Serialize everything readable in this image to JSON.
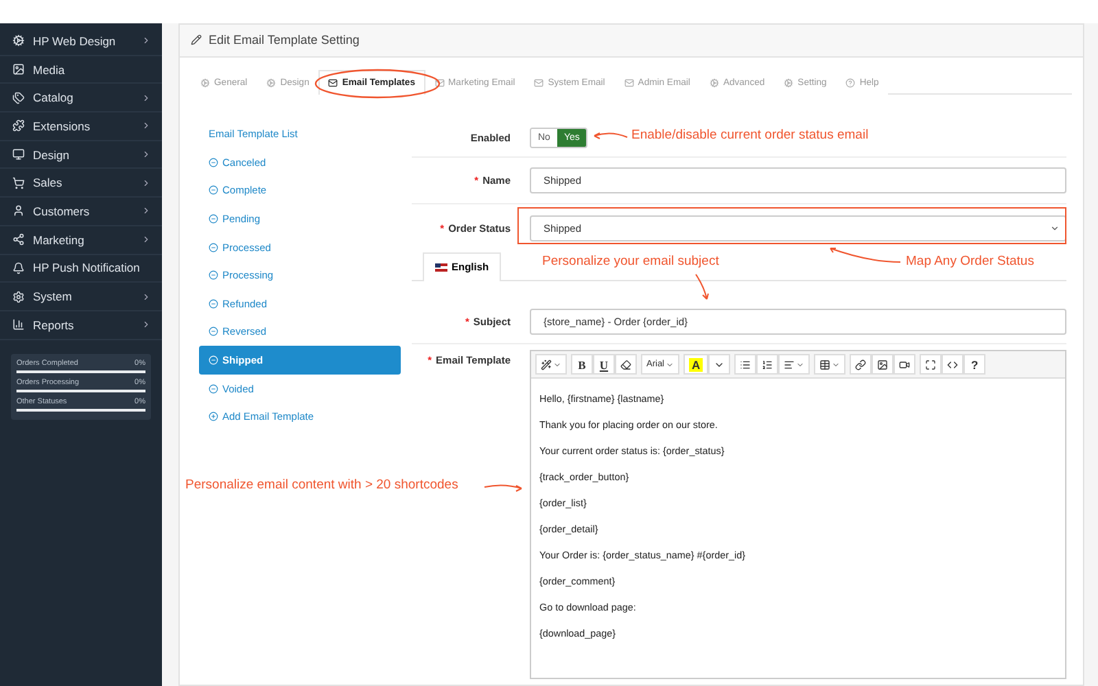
{
  "sidebar": {
    "items": [
      {
        "label": "HP Web Design",
        "has_children": true
      },
      {
        "label": "Media",
        "has_children": false
      },
      {
        "label": "Catalog",
        "has_children": true
      },
      {
        "label": "Extensions",
        "has_children": true
      },
      {
        "label": "Design",
        "has_children": true
      },
      {
        "label": "Sales",
        "has_children": true
      },
      {
        "label": "Customers",
        "has_children": true
      },
      {
        "label": "Marketing",
        "has_children": true
      },
      {
        "label": "HP Push Notification",
        "has_children": false
      },
      {
        "label": "System",
        "has_children": true
      },
      {
        "label": "Reports",
        "has_children": true
      }
    ],
    "stats": [
      {
        "label": "Orders Completed",
        "value": "0%"
      },
      {
        "label": "Orders Processing",
        "value": "0%"
      },
      {
        "label": "Other Statuses",
        "value": "0%"
      }
    ]
  },
  "panel": {
    "title": "Edit Email Template Setting",
    "tabs": [
      {
        "label": "General",
        "selected": false
      },
      {
        "label": "Design",
        "selected": false
      },
      {
        "label": "Email Templates",
        "selected": true
      },
      {
        "label": "Marketing Email",
        "selected": false
      },
      {
        "label": "System Email",
        "selected": false
      },
      {
        "label": "Admin Email",
        "selected": false
      },
      {
        "label": "Advanced",
        "selected": false
      },
      {
        "label": "Setting",
        "selected": false
      },
      {
        "label": "Help",
        "selected": false
      }
    ],
    "template_list": {
      "title": "Email Template List",
      "items": [
        {
          "label": "Canceled",
          "selected": false
        },
        {
          "label": "Complete",
          "selected": false
        },
        {
          "label": "Pending",
          "selected": false
        },
        {
          "label": "Processed",
          "selected": false
        },
        {
          "label": "Processing",
          "selected": false
        },
        {
          "label": "Refunded",
          "selected": false
        },
        {
          "label": "Reversed",
          "selected": false
        },
        {
          "label": "Shipped",
          "selected": true
        },
        {
          "label": "Voided",
          "selected": false
        }
      ],
      "add_label": "Add Email Template"
    },
    "form": {
      "enabled": {
        "label": "Enabled",
        "options": [
          {
            "label": "No",
            "selected": false
          },
          {
            "label": "Yes",
            "selected": true
          }
        ]
      },
      "name": {
        "label": "Name",
        "required_mark": "*",
        "value": "Shipped"
      },
      "order_status": {
        "label": "Order Status",
        "required_mark": "*",
        "value": "Shipped"
      },
      "language_tab": {
        "label": "English",
        "selected": true
      },
      "subject": {
        "label": "Subject",
        "required_mark": "*",
        "value": "{store_name} - Order {order_id}"
      },
      "email_template": {
        "label": "Email Template",
        "required_mark": "*",
        "toolbar_labels": [
          "B",
          "U",
          "Arial",
          "A",
          "?"
        ],
        "lines": [
          "Hello, {firstname} {lastname}",
          "Thank you for placing order on our store.",
          "Your current order status is: {order_status}",
          "{track_order_button}",
          "{order_list}",
          "{order_detail}",
          "Your Order is: {order_status_name} #{order_id}",
          "{order_comment}",
          "Go to download page:",
          "{download_page}"
        ]
      }
    }
  },
  "annotations": [
    "Enable/disable current order status email",
    "Personalize your email subject",
    "Map Any Order Status",
    "Personalize email content with > 20 shortcodes"
  ]
}
